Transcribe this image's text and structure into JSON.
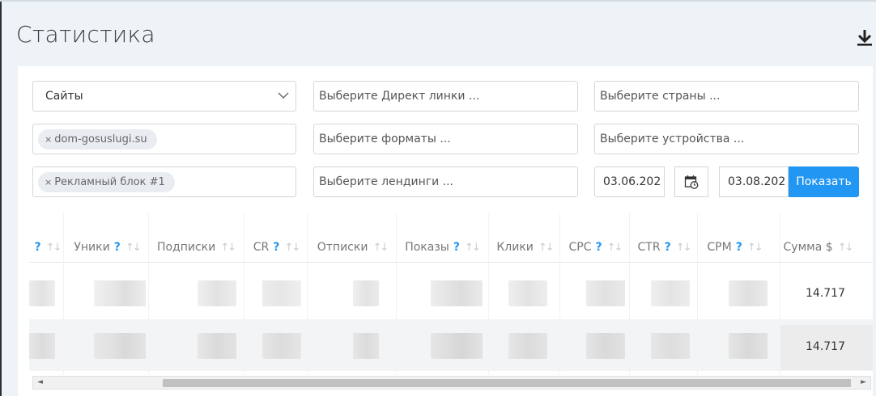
{
  "header": {
    "title": "Статистика",
    "download_icon": "download-icon"
  },
  "filters": {
    "type_select": {
      "value": "Сайты"
    },
    "direct_links": {
      "placeholder": "Выберите Директ линки ..."
    },
    "countries": {
      "placeholder": "Выберите страны ..."
    },
    "site_tag": {
      "value": "dom-gosuslugi.su"
    },
    "formats": {
      "placeholder": "Выберите форматы ..."
    },
    "devices": {
      "placeholder": "Выберите устройства ..."
    },
    "ad_block_tag": {
      "value": "Рекламный блок #1"
    },
    "landings": {
      "placeholder": "Выберите лендинги ..."
    },
    "date_from": "03.06.202",
    "date_to": "03.08.202",
    "show_button": "Показать",
    "tag_remove": "×"
  },
  "table": {
    "columns": [
      {
        "label": "",
        "help": "?",
        "sort": "↑↓"
      },
      {
        "label": "Уники",
        "help": "?",
        "sort": "↑↓"
      },
      {
        "label": "Подписки",
        "help": "",
        "sort": "↑↓"
      },
      {
        "label": "CR",
        "help": "?",
        "sort": "↑↓"
      },
      {
        "label": "Отписки",
        "help": "",
        "sort": "↑↓"
      },
      {
        "label": "Показы",
        "help": "?",
        "sort": "↑↓"
      },
      {
        "label": "Клики",
        "help": "",
        "sort": "↑↓"
      },
      {
        "label": "CPC",
        "help": "?",
        "sort": "↑↓"
      },
      {
        "label": "CTR",
        "help": "?",
        "sort": "↑↓"
      },
      {
        "label": "CPM",
        "help": "?",
        "sort": "↑↓"
      },
      {
        "label": "Сумма $",
        "help": "",
        "sort": "↑↓"
      }
    ],
    "rows": [
      {
        "sum": "14.717"
      },
      {
        "sum": "14.717"
      }
    ]
  },
  "scrollbar": {
    "left_arrow": "◄",
    "right_arrow": "►"
  },
  "colors": {
    "accent": "#2196f3",
    "background": "#eef3f7",
    "panel": "#ffffff"
  }
}
